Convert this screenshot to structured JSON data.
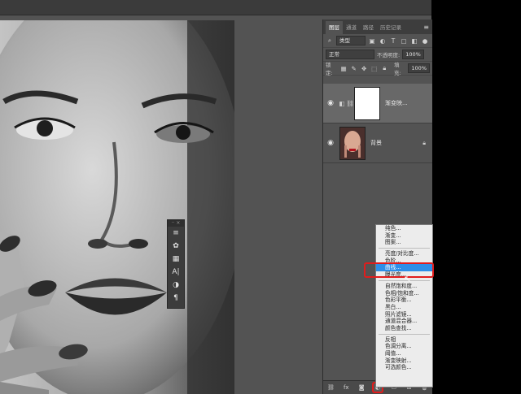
{
  "panel": {
    "tabs": [
      "图层",
      "通道",
      "路径",
      "历史记录"
    ],
    "filter_kind": "类型",
    "blend_mode": "正常",
    "opacity_label": "不透明度:",
    "opacity_value": "100%",
    "lock_label": "锁定:",
    "fill_label": "填充:",
    "fill_value": "100%"
  },
  "layers": [
    {
      "name": "渐变映...",
      "selected": true
    },
    {
      "name": "背景",
      "selected": false
    }
  ],
  "menu": {
    "items": [
      "纯色...",
      "渐变...",
      "图案...",
      "---",
      "亮度/对比度...",
      "色阶...",
      "曲线...",
      "曝光度...",
      "---",
      "自然饱和度...",
      "色相/饱和度...",
      "色彩平衡...",
      "黑白...",
      "照片滤镜...",
      "通道混合器...",
      "颜色查找...",
      "---",
      "反相",
      "色调分离...",
      "阈值...",
      "渐变映射...",
      "可选颜色..."
    ],
    "highlighted": "曲线..."
  },
  "bottom_icons": [
    "link-icon",
    "fx-icon",
    "mask-icon",
    "adjustment-icon",
    "folder-icon",
    "new-layer-icon",
    "trash-icon"
  ],
  "mini_toolbar_glyphs": [
    "≡",
    "✿",
    "▦",
    "A|",
    "◑",
    "¶"
  ],
  "colors": {
    "highlight": "#2d8ee8",
    "annotation": "#e11c1c"
  }
}
